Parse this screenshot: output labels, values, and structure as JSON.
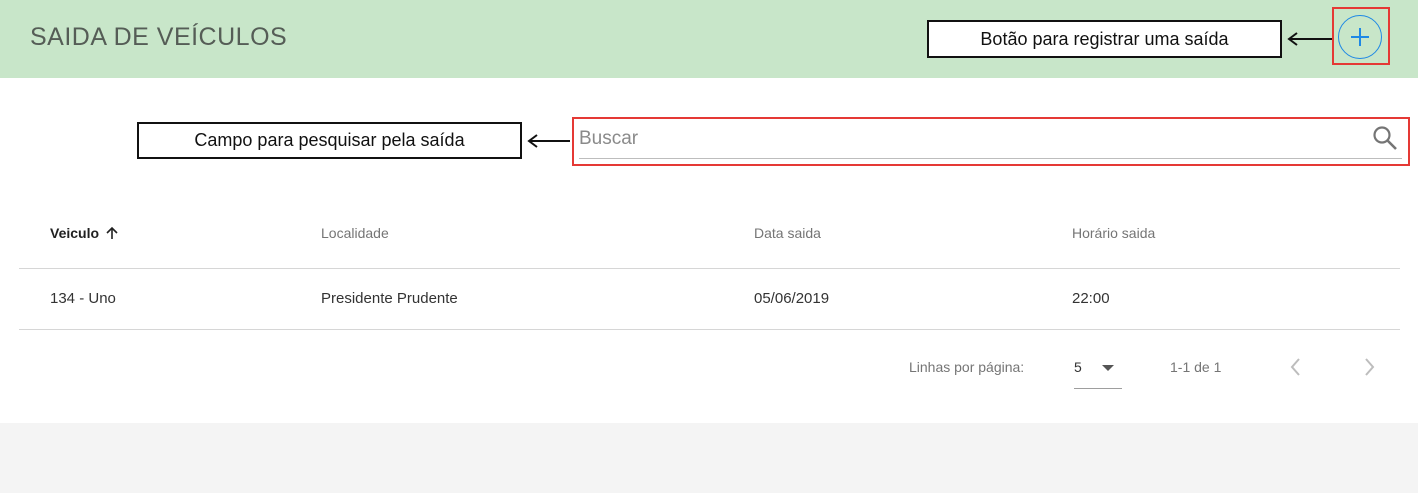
{
  "header": {
    "title": "SAIDA DE VEÍCULOS",
    "add_button_icon": "plus-icon",
    "accent_color": "#c8e6c9"
  },
  "annotations": {
    "add_button_callout": "Botão para registrar uma saída",
    "search_callout": "Campo para pesquisar pela saída",
    "highlight_color": "#e53935"
  },
  "search": {
    "placeholder": "Buscar",
    "value": "",
    "icon": "search-icon"
  },
  "table": {
    "columns": [
      {
        "label": "Veiculo",
        "sorted": "asc"
      },
      {
        "label": "Localidade"
      },
      {
        "label": "Data saida"
      },
      {
        "label": "Horário saida"
      }
    ],
    "rows": [
      [
        "134 - Uno",
        "Presidente Prudente",
        "05/06/2019",
        "22:00"
      ]
    ]
  },
  "pagination": {
    "rows_per_page_label": "Linhas por página:",
    "rows_per_page_value": "5",
    "range_text": "1-1 de 1",
    "prev_icon": "chevron-left-icon",
    "next_icon": "chevron-right-icon"
  }
}
